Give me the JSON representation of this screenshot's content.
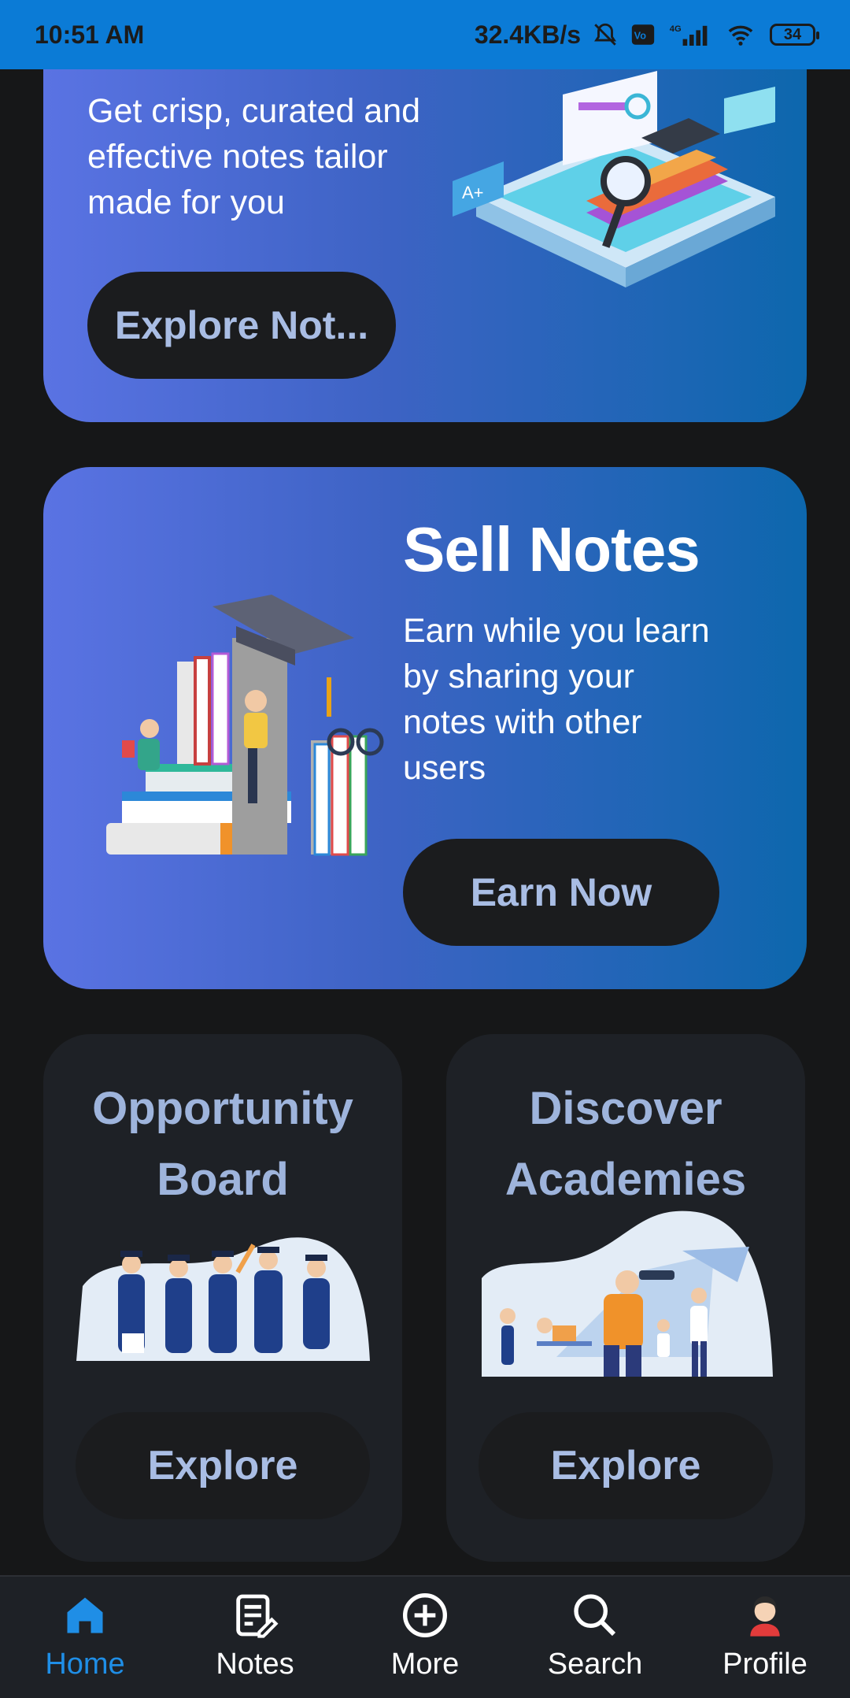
{
  "status_bar": {
    "time": "10:51 AM",
    "network_speed": "32.4KB/s",
    "battery_level": "34",
    "icons": [
      "mute-icon",
      "volte-icon",
      "signal-4g-icon",
      "wifi-icon",
      "battery-icon"
    ]
  },
  "notes_card": {
    "description": "Get crisp, curated and effective notes tailor made for you",
    "button_label": "Explore Not..."
  },
  "sell_card": {
    "title": "Sell Notes",
    "description": "Earn while you learn by sharing your notes with other users",
    "button_label": "Earn Now"
  },
  "opportunity_card": {
    "title": "Opportunity Board",
    "button_label": "Explore"
  },
  "academies_card": {
    "title": "Discover Academies",
    "button_label": "Explore"
  },
  "bottom_nav": {
    "items": [
      {
        "label": "Home",
        "icon": "home-icon",
        "active": true
      },
      {
        "label": "Notes",
        "icon": "notes-icon",
        "active": false
      },
      {
        "label": "More",
        "icon": "plus-circle-icon",
        "active": false
      },
      {
        "label": "Search",
        "icon": "search-icon",
        "active": false
      },
      {
        "label": "Profile",
        "icon": "avatar-icon",
        "active": false
      }
    ]
  },
  "colors": {
    "status_bar": "#0b7bd6",
    "background": "#161718",
    "accent": "#1f8ee6",
    "button_text": "#a9bde4",
    "card_title": "#9eb4dc"
  }
}
